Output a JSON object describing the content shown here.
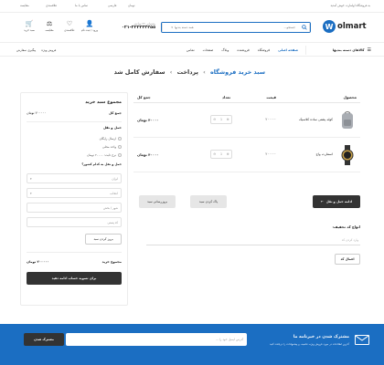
{
  "topbar": {
    "left_items": [
      "مقایسه",
      "علاقمندی",
      "تماس با ما"
    ],
    "right_items": [
      "به فروشگاه اولمارت خوش آمدید"
    ],
    "lang": "فارسی",
    "currency": "تومان"
  },
  "header": {
    "logo_text": "olmart",
    "logo_letter": "W",
    "search_placeholder": "جستجو...",
    "search_category": "همه دسته بندیها",
    "phone_label": "پشتیبانی ۲۴ ساعته",
    "phone_number": "۰۲۱-۲۲۲۳۳۴۴۵۵",
    "icons": [
      {
        "label": "سبد خرید",
        "glyph": "🛒",
        "name": "cart-icon"
      },
      {
        "label": "مقایسه",
        "glyph": "⚖",
        "name": "compare-icon"
      },
      {
        "label": "علاقمندی",
        "glyph": "♡",
        "name": "heart-icon"
      },
      {
        "label": "ورود / ثبت نام",
        "glyph": "👤",
        "name": "user-icon"
      }
    ]
  },
  "nav": {
    "categories_label": "کالاهای دسته بندیها",
    "items": [
      "صفحه اصلی",
      "فروشگاه",
      "فروشنده",
      "وبلاگ",
      "صفحات",
      "تماس"
    ],
    "right_links": [
      "پیگیری سفارش",
      "فروش ویژه"
    ]
  },
  "steps": {
    "step1": "سبد خرید فروشگاه",
    "step2": "پرداخت",
    "step3": "سفارش کامل شد"
  },
  "table": {
    "headers": {
      "product": "محصول",
      "price": "قیمت",
      "qty": "تعداد",
      "total": "جمع کل"
    },
    "rows": [
      {
        "name": "کوله پشتی ساده کلاسیک",
        "price": "۲۰۰۰۰۰",
        "qty": "1",
        "total": "۴۰۰۰۰ تومان"
      },
      {
        "name": "اسمارت واچ",
        "price": "۲۰۰۰۰۰",
        "qty": "1",
        "total": "۴۰۰۰۰ تومان"
      }
    ]
  },
  "actions": {
    "add_to_cart": "ادامه حمل و نقل",
    "continue": "پاک کردن سبد",
    "update": "بروزرسانی سبد"
  },
  "coupon": {
    "title": "انواع کد تخفیف:",
    "placeholder": "وارد کردن کد",
    "apply": "اعمال کد"
  },
  "summary": {
    "title": "مجموع سبد خرید",
    "subtotal_label": "جمع کل",
    "subtotal_value": "۲۰۰۰۰۰ تومان",
    "shipping_label": "حمل و نقل",
    "options": [
      "ارسال رایگان",
      "واحد محلی",
      "نرخ ثابت: ۲۰۰۰۰ تومان"
    ],
    "shipping_note": "حمل و نقل به کدام کشور؟",
    "country_field": "ایران",
    "state_field": "انتخاب",
    "city_field": "شهر / بخش",
    "zip_field": "کد پستی",
    "update_btn": "بروز کردن سبد",
    "total_label": "مجموع خرید",
    "total_value": "۲۰۰۰۰۰ تومان",
    "checkout_btn": "برای تسویه حساب ادامه دهید"
  },
  "footer": {
    "title": "مشترک شدن در خبرنامه ما",
    "subtitle": "آخرین اطلاعات در مورد فروش ویژه، تخفیف و پیشنهادات را دریافت کنید",
    "email_placeholder": "آدرس ایمیل خود را ...",
    "subscribe_btn": "مشترک شدن"
  },
  "colors": {
    "accent": "#1b6ec2",
    "dark": "#333333"
  }
}
